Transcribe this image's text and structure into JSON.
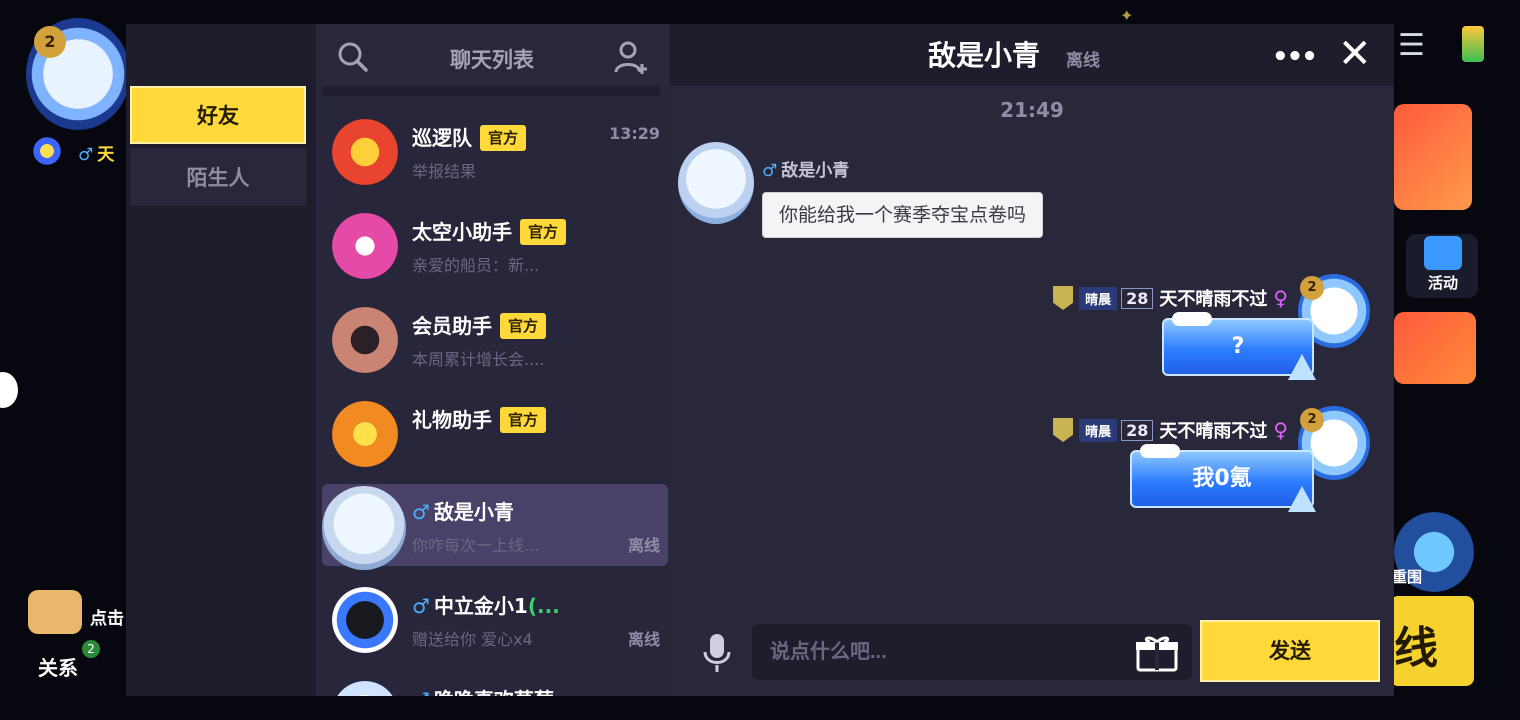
{
  "background": {
    "left": {
      "level": "2",
      "name_fragment": "天",
      "guide_text": "点击",
      "relation_label": "关系",
      "relation_badge": "2"
    },
    "right": {
      "activity_label": "活动",
      "round_label": "重围",
      "start_fragment": "线"
    }
  },
  "tabs": [
    {
      "label": "好友",
      "active": true
    },
    {
      "label": "陌生人",
      "active": false
    }
  ],
  "chat_list": {
    "title": "聊天列表",
    "search_icon": "search-icon",
    "add_icon": "add-friend-icon",
    "rows": [
      {
        "name": "巡逻队",
        "tag": "官方",
        "preview": "举报结果",
        "time": "13:29",
        "status": "",
        "avatar_color": "#e8442e"
      },
      {
        "name": "太空小助手",
        "tag": "官方",
        "preview": "亲爱的船员：新...",
        "time": "",
        "status": "",
        "avatar_color": "#e64aa8"
      },
      {
        "name": "会员助手",
        "tag": "官方",
        "preview": "本周累计增长会....",
        "time": "",
        "status": "",
        "avatar_color": "#c98474"
      },
      {
        "name": "礼物助手",
        "tag": "官方",
        "preview": "",
        "time": "",
        "status": "",
        "avatar_color": "#f28a22"
      },
      {
        "name": "敌是小青",
        "tag": "",
        "gender": "♂",
        "preview": "你咋每次一上线...",
        "time": "",
        "status": "离线",
        "avatar_color": "#dbe8f7",
        "selected": true
      },
      {
        "name": "中立金小1",
        "tag": "",
        "gender": "♂",
        "name_suffix": "(...",
        "preview": "赠送给你 爱心x4",
        "time": "",
        "status": "离线",
        "avatar_color": "#2a2a36"
      },
      {
        "name": "晚晚真欢草莓",
        "tag": "",
        "gender": "♂",
        "preview": "",
        "time": "",
        "status": "",
        "avatar_color": "#cfe3ff"
      }
    ]
  },
  "chat": {
    "title": "敌是小青",
    "status": "离线",
    "more_label": "•••",
    "close_label": "✕",
    "time_divider": "21:49",
    "incoming": {
      "gender": "♂",
      "name": "敌是小青",
      "text": "你能给我一个赛季夺宝点卷吗"
    },
    "outgoing": [
      {
        "rank": "晴晨",
        "rank_num": "28",
        "name": "天不晴雨不过",
        "gender": "♀",
        "level": "2",
        "text": "?"
      },
      {
        "rank": "晴晨",
        "rank_num": "28",
        "name": "天不晴雨不过",
        "gender": "♀",
        "level": "2",
        "text": "我0氪"
      }
    ],
    "input_placeholder": "说点什么吧...",
    "send_label": "发送"
  },
  "colors": {
    "accent": "#ffd83a",
    "panel": "#29273a",
    "sidebar": "#1f1d2c",
    "selected": "#4a4168",
    "male": "#4bb0ff"
  }
}
